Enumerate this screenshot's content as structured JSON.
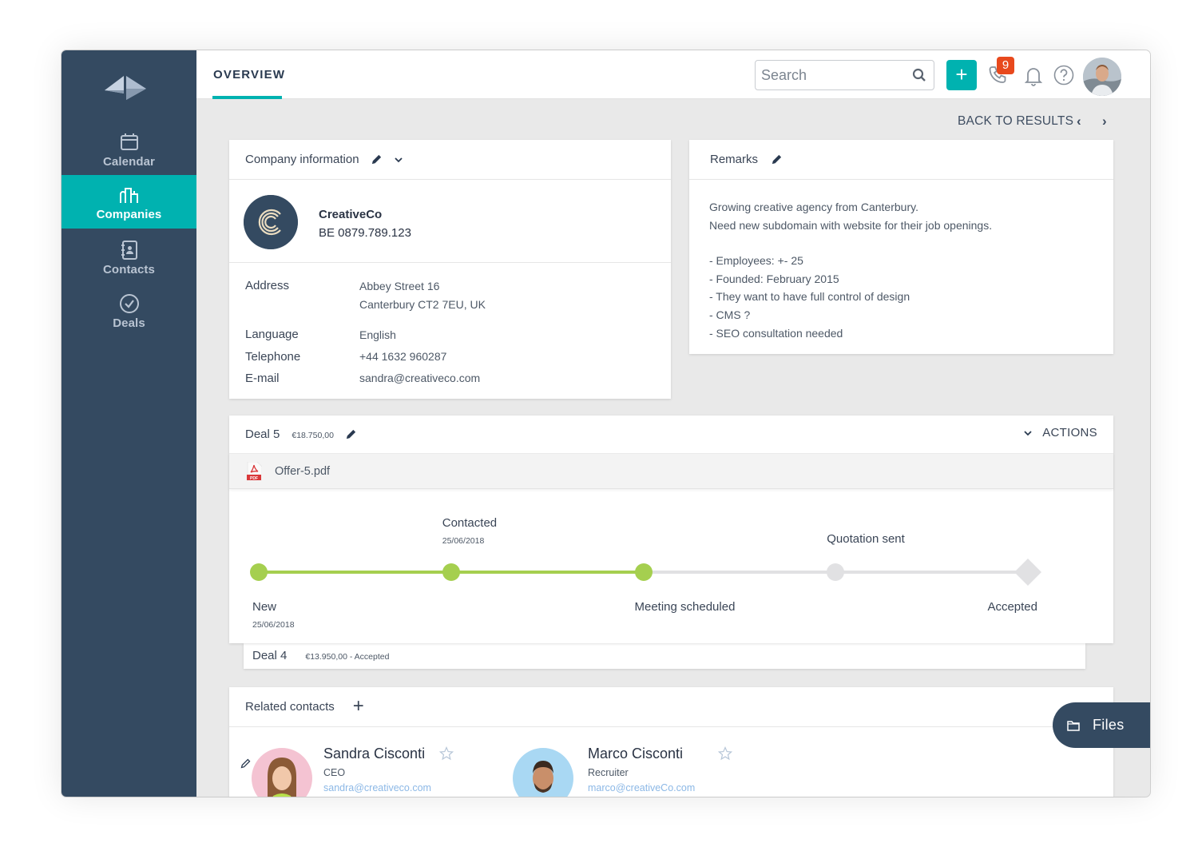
{
  "sidebar": {
    "items": [
      {
        "label": "Calendar",
        "icon": "calendar-icon",
        "active": false
      },
      {
        "label": "Companies",
        "icon": "buildings-icon",
        "active": true
      },
      {
        "label": "Contacts",
        "icon": "address-book-icon",
        "active": false
      },
      {
        "label": "Deals",
        "icon": "check-circle-icon",
        "active": false
      }
    ]
  },
  "header": {
    "tab": "OVERVIEW",
    "search_placeholder": "Search",
    "add_label": "+",
    "calls_badge": "9"
  },
  "nav": {
    "back_label": "BACK TO RESULTS",
    "prev": "‹",
    "next": "›"
  },
  "company_card": {
    "title": "Company information",
    "name": "CreativeCo",
    "vat": "BE 0879.789.123",
    "fields": [
      {
        "label": "Address",
        "value": "Abbey Street 16",
        "value2": "Canterbury CT2 7EU, UK"
      },
      {
        "label": "Language",
        "value": "English"
      },
      {
        "label": "Telephone",
        "value": "+44 1632 960287"
      },
      {
        "label": "E-mail",
        "value": "sandra@creativeco.com"
      }
    ]
  },
  "remarks_card": {
    "title": "Remarks",
    "lines": [
      "Growing creative agency from Canterbury.",
      "Need new subdomain with website for their job openings.",
      "",
      "- Employees: +- 25",
      "- Founded: February 2015",
      "- They want to have full control of design",
      "- CMS ?",
      "- SEO consultation needed"
    ]
  },
  "deal": {
    "title": "Deal 5",
    "amount": "€18.750,00",
    "actions_label": "ACTIONS",
    "file": "Offer-5.pdf",
    "progress_completed_stages": 3,
    "stages": [
      {
        "label": "New",
        "date": "25/06/2018",
        "done": true
      },
      {
        "label": "Contacted",
        "date": "25/06/2018",
        "done": true
      },
      {
        "label": "Meeting scheduled",
        "date": "",
        "done": true
      },
      {
        "label": "Quotation sent",
        "date": "",
        "done": false
      },
      {
        "label": "Accepted",
        "date": "",
        "done": false
      }
    ],
    "colors": {
      "done": "#a5cf4f",
      "pending": "#e1e1e3"
    }
  },
  "deal4": {
    "title": "Deal 4",
    "summary": "€13.950,00 - Accepted"
  },
  "contacts_card": {
    "title": "Related contacts",
    "add_label": "+",
    "contacts": [
      {
        "name": "Sandra Cisconti",
        "role": "CEO",
        "email": "sandra@creativeco.com"
      },
      {
        "name": "Marco Cisconti",
        "role": "Recruiter",
        "email": "marco@creativeCo.com"
      }
    ]
  },
  "files_button": {
    "label": "Files"
  },
  "colors": {
    "sidebar": "#344a61",
    "accent": "#00b2b0",
    "badge": "#e8491d",
    "progress": "#a5cf4f"
  }
}
